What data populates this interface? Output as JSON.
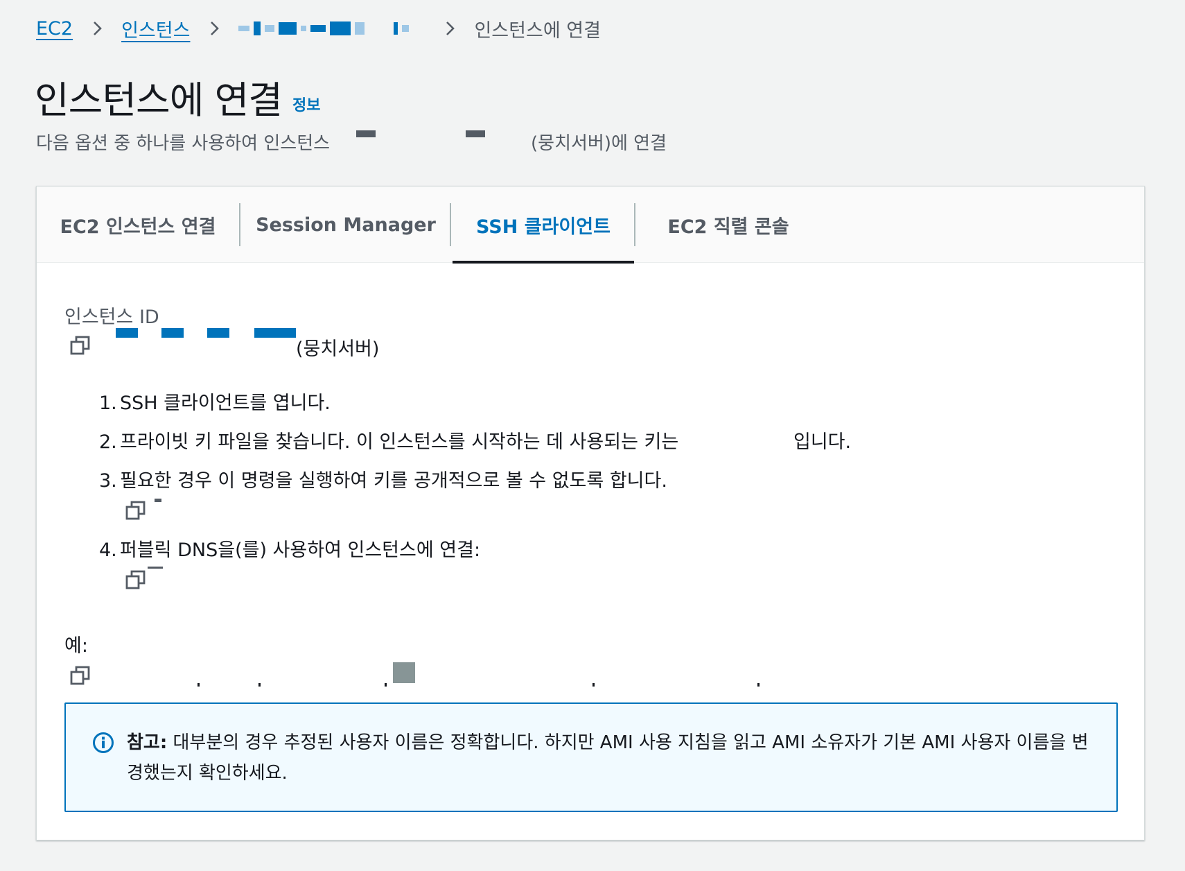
{
  "breadcrumb": {
    "ec2": "EC2",
    "instances": "인스턴스",
    "current": "인스턴스에 연결"
  },
  "header": {
    "title": "인스턴스에 연결",
    "info": "정보",
    "subtitle_prefix": "다음 옵션 중 하나를 사용하여 인스턴스",
    "subtitle_suffix": "(뭉치서버)에 연결"
  },
  "tabs": [
    {
      "label": "EC2 인스턴스 연결",
      "active": false
    },
    {
      "label": "Session Manager",
      "active": false
    },
    {
      "label": "SSH 클라이언트",
      "active": true
    },
    {
      "label": "EC2 직렬 콘솔",
      "active": false
    }
  ],
  "instance": {
    "label": "인스턴스 ID",
    "name_suffix": "(뭉치서버)"
  },
  "steps": [
    {
      "num": "1.",
      "text": "SSH 클라이언트를 엽니다."
    },
    {
      "num": "2.",
      "text": "프라이빗 키 파일을 찾습니다. 이 인스턴스를 시작하는 데 사용되는 키는",
      "tail": "입니다."
    },
    {
      "num": "3.",
      "text": "필요한 경우 이 명령을 실행하여 키를 공개적으로 볼 수 없도록 합니다."
    },
    {
      "num": "4.",
      "text": "퍼블릭 DNS을(를) 사용하여 인스턴스에 연결:"
    }
  ],
  "example": {
    "label": "예:"
  },
  "alert": {
    "strong": "참고:",
    "text": " 대부분의 경우 추정된 사용자 이름은 정확합니다. 하지만 AMI 사용 지침을 읽고 AMI 소유자가 기본 AMI 사용자 이름을 변경했는지 확인하세요."
  },
  "colors": {
    "link": "#0073bb",
    "text": "#16191f",
    "muted": "#545b64",
    "background": "#f2f3f3",
    "alert_bg": "#f1faff"
  },
  "icons": [
    "chevron-right-icon",
    "copy-icon",
    "info-icon"
  ]
}
